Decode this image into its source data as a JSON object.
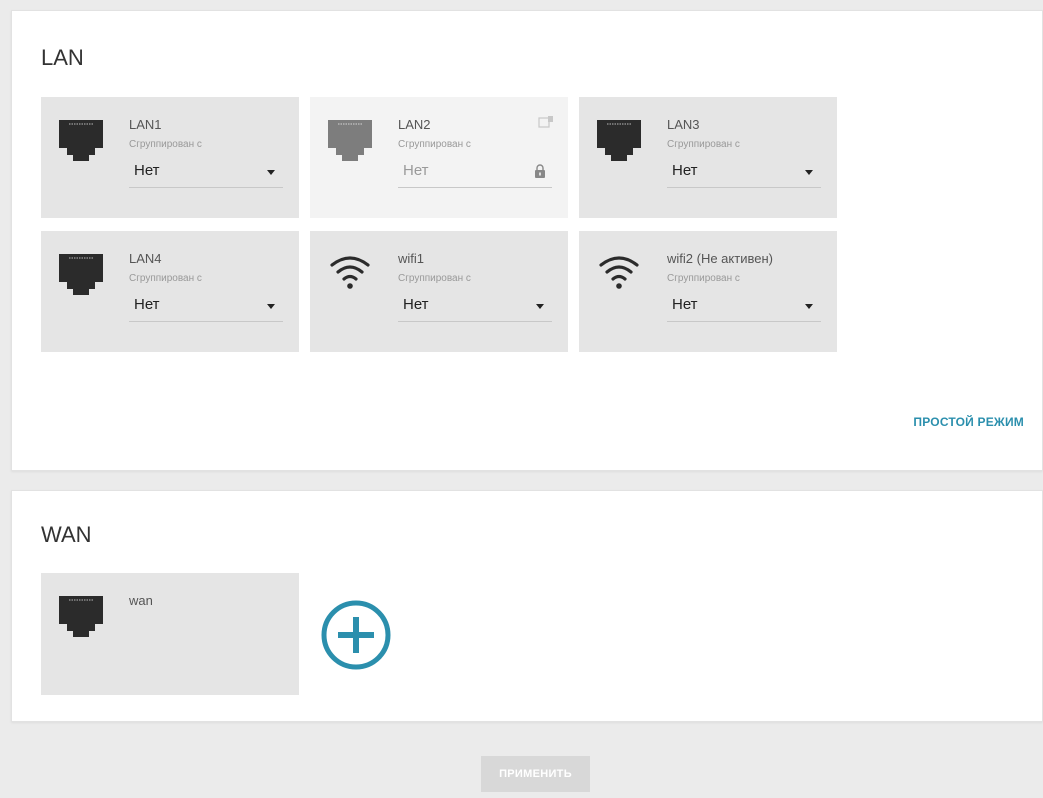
{
  "lan": {
    "title": "LAN",
    "simple_mode": "ПРОСТОЙ РЕЖИМ",
    "cards": [
      {
        "name": "LAN1",
        "subtitle": "Сгруппирован с",
        "value": "Нет",
        "icon": "ethernet-port-icon",
        "locked": false
      },
      {
        "name": "LAN2",
        "subtitle": "Сгруппирован с",
        "value": "Нет",
        "icon": "ethernet-port-icon",
        "locked": true
      },
      {
        "name": "LAN3",
        "subtitle": "Сгруппирован с",
        "value": "Нет",
        "icon": "ethernet-port-icon",
        "locked": false
      },
      {
        "name": "LAN4",
        "subtitle": "Сгруппирован с",
        "value": "Нет",
        "icon": "ethernet-port-icon",
        "locked": false
      },
      {
        "name": "wifi1",
        "subtitle": "Сгруппирован с",
        "value": "Нет",
        "icon": "wifi-icon",
        "locked": false
      },
      {
        "name": "wifi2 (Не активен)",
        "subtitle": "Сгруппирован с",
        "value": "Нет",
        "icon": "wifi-icon",
        "locked": false
      }
    ]
  },
  "wan": {
    "title": "WAN",
    "cards": [
      {
        "name": "wan",
        "icon": "ethernet-port-icon"
      }
    ],
    "add_icon": "plus-circle-icon"
  },
  "footer": {
    "apply_label": "ПРИМЕНИТЬ"
  },
  "colors": {
    "accent": "#2b8fad",
    "card_bg": "#e5e5e5",
    "card_locked_bg": "#f3f3f3",
    "page_bg": "#ebebeb"
  }
}
